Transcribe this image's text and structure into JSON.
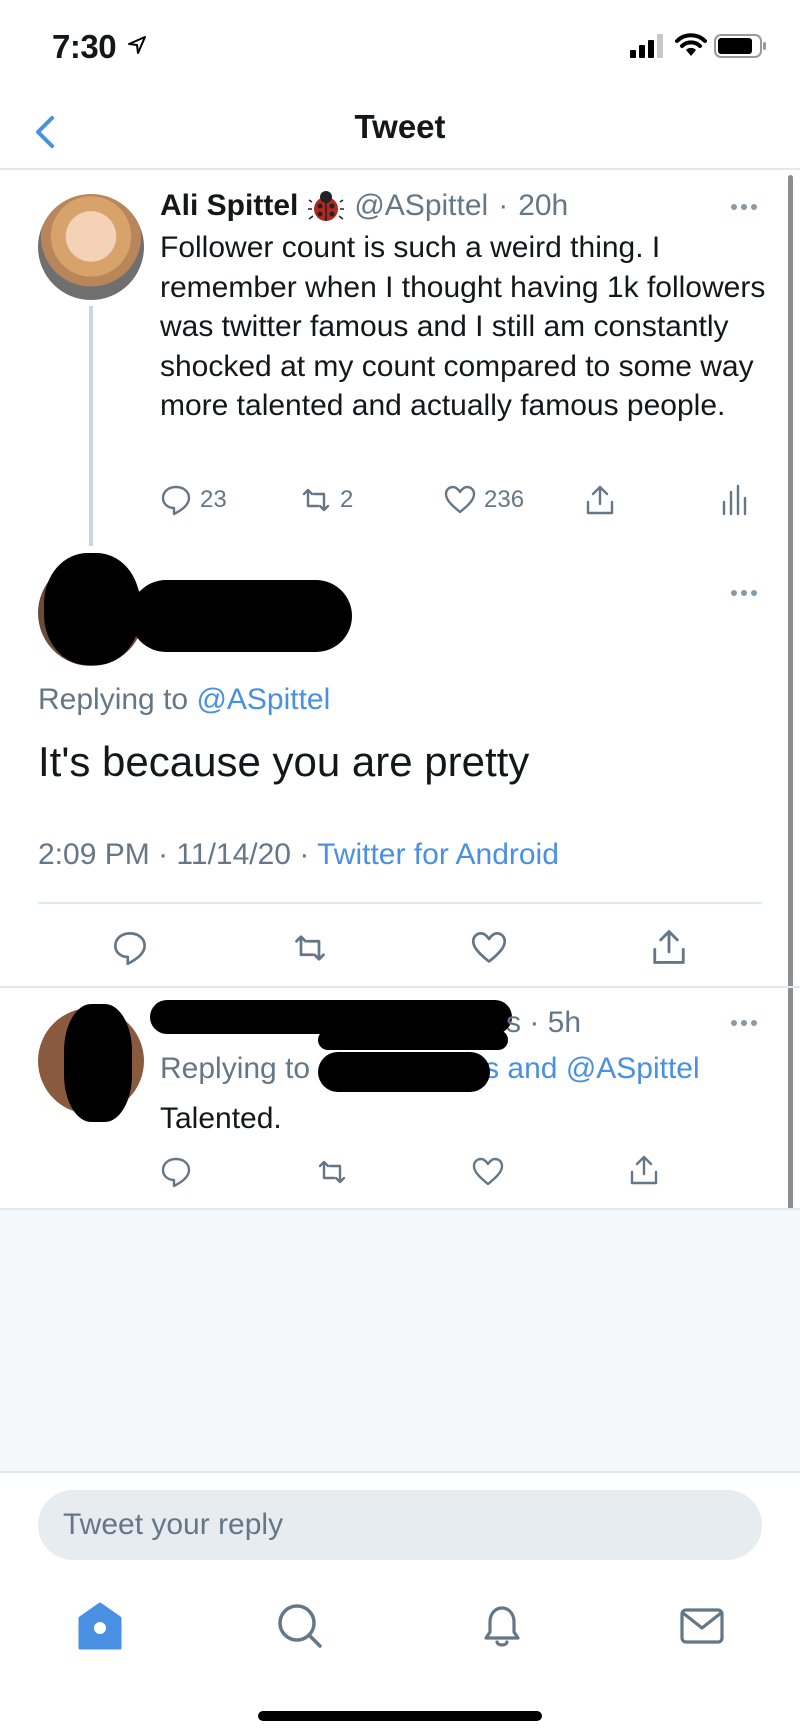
{
  "status_bar": {
    "time": "7:30"
  },
  "nav": {
    "title": "Tweet"
  },
  "tweet_main": {
    "name": "Ali Spittel",
    "handle": "@ASpittel",
    "separator": "·",
    "age": "20h",
    "text": "Follower count is such a weird thing. I remember when I thought having 1k followers was twitter famous and I still am constantly shocked at my count compared to some way more talented and actually famous people.",
    "replies": "23",
    "retweets": "2",
    "likes": "236"
  },
  "tweet_focus": {
    "replying_prefix": "Replying to",
    "replying_handle": "@ASpittel",
    "text": "It's because you are pretty",
    "time": "2:09 PM",
    "date": "11/14/20",
    "dot": "·",
    "source": "Twitter for Android"
  },
  "tweet_reply": {
    "age": "s · 5h",
    "replying_prefix": "Replying to",
    "replying_suffix": "s and @ASpittel",
    "text": "Talented."
  },
  "reply_box": {
    "placeholder": "Tweet your reply"
  },
  "icons": {
    "back": "chevron-left-icon",
    "reply": "speech-bubble-icon",
    "retweet": "retweet-icon",
    "like": "heart-icon",
    "share": "share-icon",
    "analytics": "bar-chart-icon",
    "home": "home-icon",
    "search": "search-icon",
    "notifications": "bell-icon",
    "messages": "mail-icon"
  },
  "colors": {
    "accent": "#4a90e2",
    "muted": "#657786",
    "divider": "#e1e8ed"
  }
}
